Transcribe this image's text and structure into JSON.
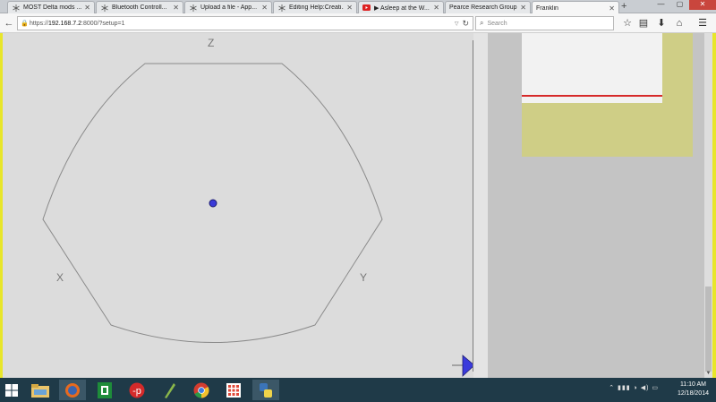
{
  "browser": {
    "tabs": [
      {
        "title": "MOST Delta mods ...",
        "icon": "snowflake-icon",
        "active": false
      },
      {
        "title": "Bluetooth Controll...",
        "icon": "snowflake-icon",
        "active": false
      },
      {
        "title": "Upload a file - App...",
        "icon": "snowflake-icon",
        "active": false
      },
      {
        "title": "Editing Help:Creati...",
        "icon": "snowflake-icon",
        "active": false
      },
      {
        "title": "▶ Asleep at the W...",
        "icon": "youtube-icon",
        "active": false
      },
      {
        "title": "Pearce Research Group...",
        "icon": "",
        "active": false
      },
      {
        "title": "Franklin",
        "icon": "",
        "active": true
      }
    ],
    "new_tab_label": "+",
    "url_prefix": "https://",
    "url_host": "192.168.7.2",
    "url_rest": ":8000/?setup=1",
    "search_placeholder": "Search"
  },
  "plot": {
    "label_z": "Z",
    "label_x": "X",
    "label_y": "Y",
    "colors": {
      "boundary": "#8a8a8a",
      "point_fill": "#3a3ad8",
      "arrow_fill": "#3b3bdc",
      "red_line": "#d62a2a",
      "olive": "#cfce86",
      "side_bar": "#e8e62a"
    }
  },
  "taskbar": {
    "time": "11:10 AM",
    "date": "12/18/2014",
    "apps": [
      "windows-start-icon",
      "file-explorer-icon",
      "firefox-icon",
      "excel-icon",
      "p-app-icon",
      "pen-app-icon",
      "chrome-icon",
      "apps-grid-icon",
      "python-icon"
    ]
  }
}
